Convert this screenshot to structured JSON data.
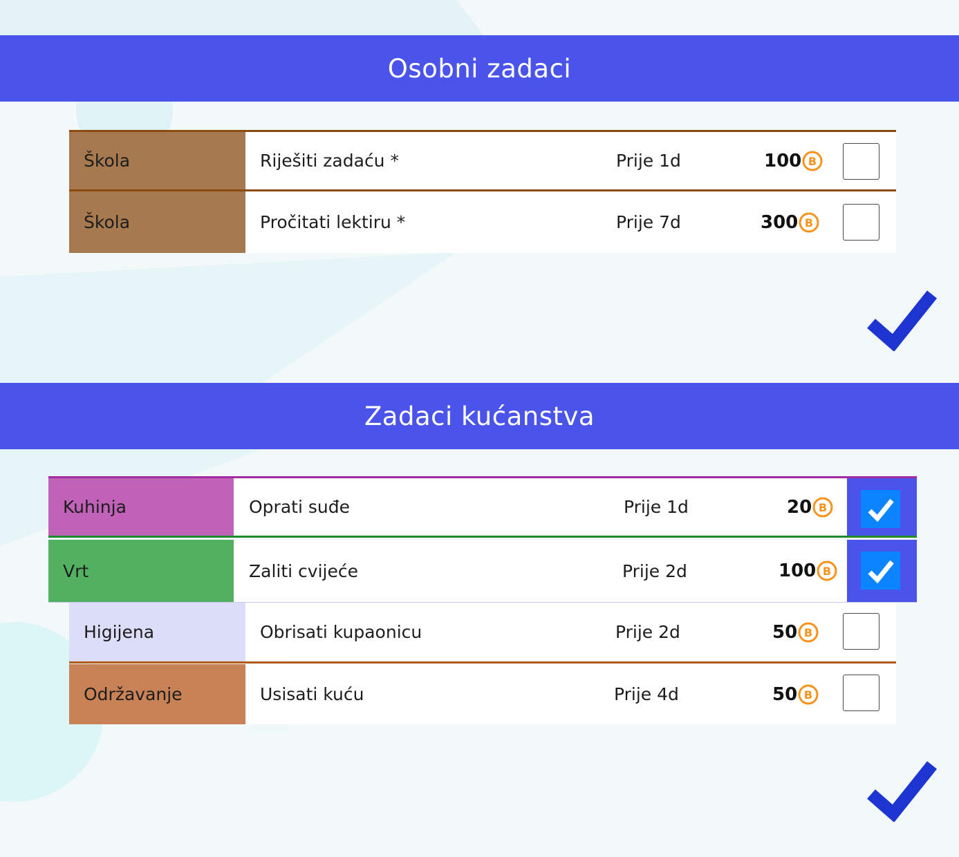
{
  "colors": {
    "header": "#4a53ea",
    "coin": "#f7931a",
    "check_blue": "#1f35d1",
    "checked_box": "#0b84ff"
  },
  "personal": {
    "title": "Osobni zadaci",
    "tasks": [
      {
        "category": "Škola",
        "name": "Riješiti zadaću *",
        "deadline": "Prije 1d",
        "points": "100",
        "done": false,
        "category_color": "#a67a4e"
      },
      {
        "category": "Škola",
        "name": "Pročitati lektiru *",
        "deadline": "Prije 7d",
        "points": "300",
        "done": false,
        "category_color": "#a67a4e"
      }
    ],
    "confirm_icon": "checkmark-icon"
  },
  "household": {
    "title": "Zadaci kućanstva",
    "tasks": [
      {
        "category": "Kuhinja",
        "name": "Oprati suđe",
        "deadline": "Prije 1d",
        "points": "20",
        "done": true,
        "category_color": "#c062b8"
      },
      {
        "category": "Vrt",
        "name": "Zaliti cvijeće",
        "deadline": "Prije 2d",
        "points": "100",
        "done": true,
        "category_color": "#52b061"
      },
      {
        "category": "Higijena",
        "name": "Obrisati kupaonicu",
        "deadline": "Prije 2d",
        "points": "50",
        "done": false,
        "category_color": "#dcddf8"
      },
      {
        "category": "Održavanje",
        "name": "Usisati kuću",
        "deadline": "Prije 4d",
        "points": "50",
        "done": false,
        "category_color": "#c88256"
      }
    ],
    "confirm_icon": "checkmark-icon"
  }
}
